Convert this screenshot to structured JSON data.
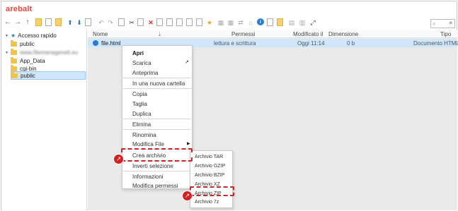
{
  "app": {
    "logo": "arebalt"
  },
  "search": {
    "placeholder": "",
    "clear": "×"
  },
  "toolbar": {
    "back": "←",
    "forward": "→",
    "up": "↑",
    "upload": "⬆",
    "download": "⬇",
    "undo": "↶",
    "redo": "↷",
    "cut": "✂",
    "delete": "✕",
    "star": "★",
    "info": "i",
    "fullscreen": "⤢"
  },
  "sidebar": {
    "quick_access": "Accesso rapido",
    "quick_items": [
      "public"
    ],
    "site_root": "www.filemanagerwtt.eu",
    "site_children": [
      "App_Data",
      "cgi-bin",
      "public"
    ]
  },
  "columns": {
    "name": "Nome",
    "permissions": "Permessi",
    "modified": "Modificato il",
    "size": "Dimensione",
    "type": "Tipo"
  },
  "file": {
    "name": "file.html",
    "permissions": "lettura e scrittura",
    "modified": "Oggi 11:14",
    "size": "0 b",
    "type": "Documento HTML"
  },
  "context_menu": {
    "open": "Apri",
    "download": "Scarica",
    "preview": "Anteprima",
    "new_folder": "In una nuova cartella",
    "copy": "Copia",
    "cut": "Taglia",
    "duplicate": "Duplica",
    "delete": "Elimina",
    "rename": "Rinomina",
    "edit_file": "Modifica File",
    "create_archive": "Crea archivio",
    "invert_selection": "Inverti selezione",
    "info": "Informazioni",
    "permissions": "Modifica permessi"
  },
  "archive_menu": [
    "Archivio TAR",
    "Archivio GZIP",
    "Archivio BZIP",
    "Archivio XZ",
    "Archivio ZIP",
    "Archivio 7z"
  ],
  "colors": {
    "highlight": "#c62828",
    "selection": "#cfe6fb",
    "accent": "#2a7bd4"
  }
}
